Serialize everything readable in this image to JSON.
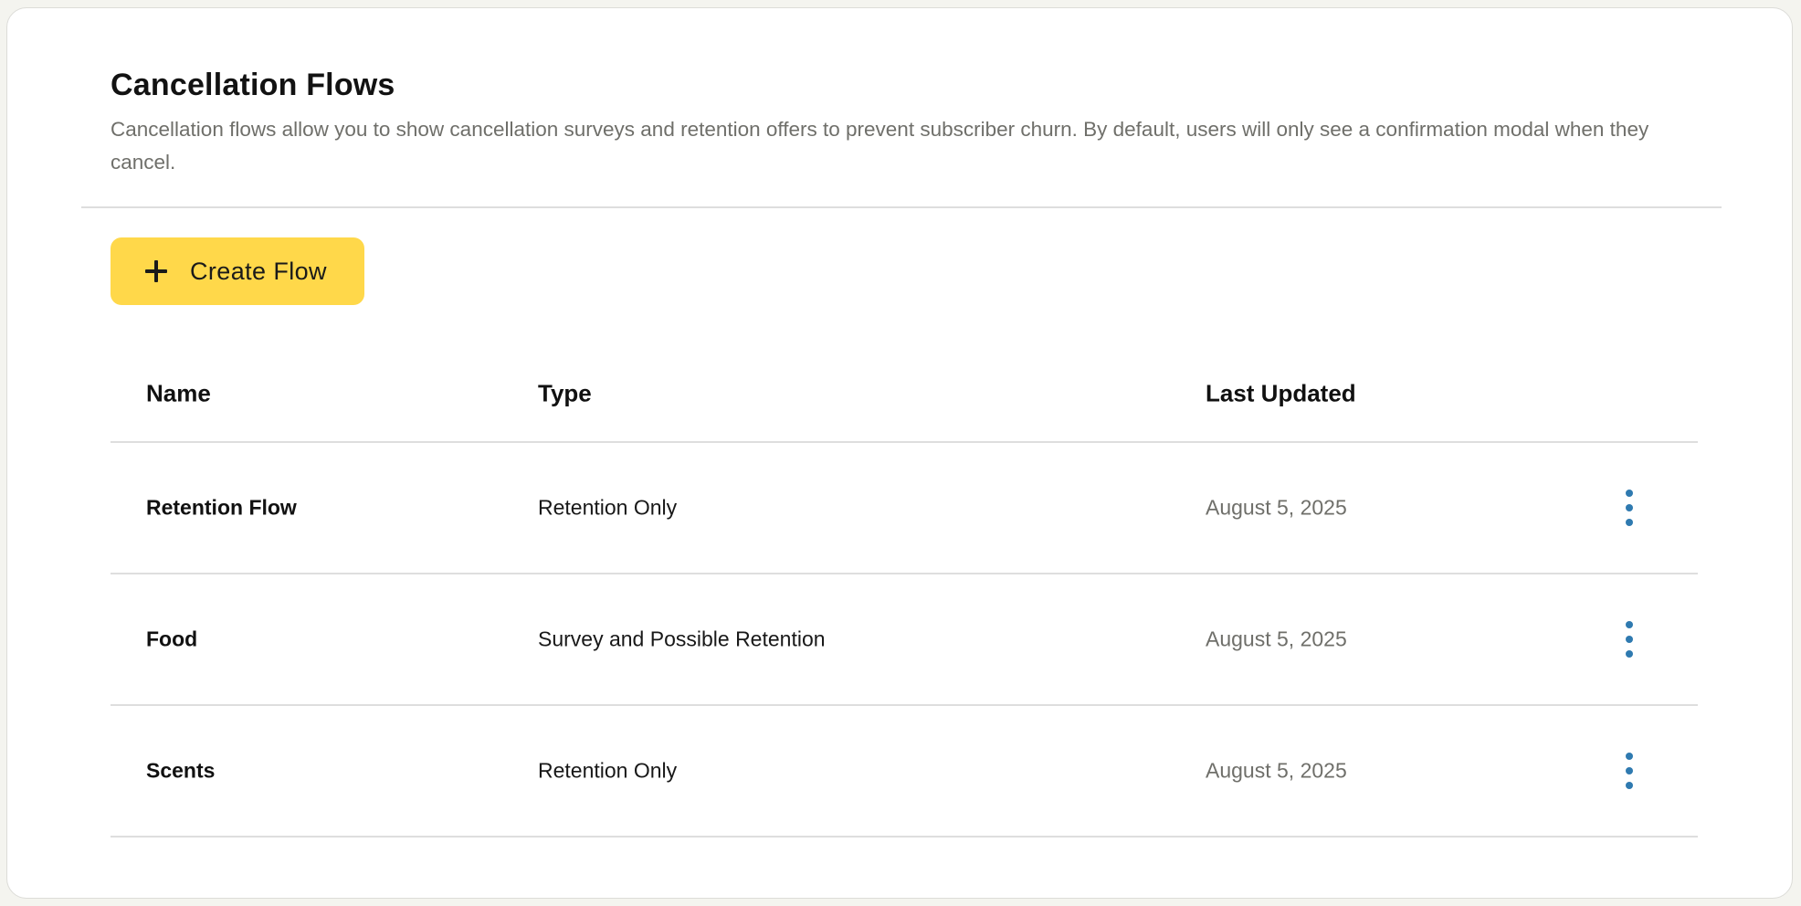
{
  "header": {
    "title": "Cancellation Flows",
    "description": "Cancellation flows allow you to show cancellation surveys and retention offers to prevent subscriber churn. By default, users will only see a confirmation modal when they cancel."
  },
  "actions": {
    "create_label": "Create Flow",
    "create_icon": "plus-icon"
  },
  "table": {
    "columns": {
      "name": "Name",
      "type": "Type",
      "last_updated": "Last Updated"
    },
    "rows": [
      {
        "name": "Retention Flow",
        "type": "Retention Only",
        "last_updated": "August 5, 2025",
        "menu_icon": "more-vertical-icon"
      },
      {
        "name": "Food",
        "type": "Survey and Possible Retention",
        "last_updated": "August 5, 2025",
        "menu_icon": "more-vertical-icon"
      },
      {
        "name": "Scents",
        "type": "Retention Only",
        "last_updated": "August 5, 2025",
        "menu_icon": "more-vertical-icon"
      }
    ]
  },
  "colors": {
    "accent_button": "#ffd84a",
    "menu_icon": "#2f7ab0",
    "muted_text": "#6f6f6a",
    "divider": "#dedede"
  }
}
